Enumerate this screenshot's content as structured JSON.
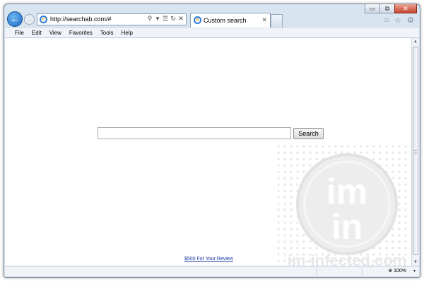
{
  "window": {
    "caption": {
      "minimize": "▭",
      "restore": "⧉",
      "close": "✕"
    }
  },
  "toolbar": {
    "back_icon": "back-arrow-icon",
    "forward_icon": "forward-arrow-icon",
    "back_glyph": "←",
    "forward_glyph": "→"
  },
  "address": {
    "url": "http://searchab.com/#",
    "icons": [
      "search-icon",
      "dropdown-icon",
      "compat-view-icon",
      "refresh-icon",
      "stop-icon"
    ],
    "icon_glyphs": [
      "⚲",
      "▾",
      "☰",
      "↻",
      "✕"
    ]
  },
  "tabs": [
    {
      "label": "Custom search",
      "close": "✕"
    }
  ],
  "right_toolbar": {
    "icons": [
      "home-icon",
      "favorites-icon",
      "tools-gear-icon"
    ],
    "glyphs": [
      "⌂",
      "☆",
      "⚙"
    ]
  },
  "menu": {
    "items": [
      "File",
      "Edit",
      "View",
      "Favorites",
      "Tools",
      "Help"
    ]
  },
  "page": {
    "search_input_value": "",
    "search_button": "Search",
    "review_link": "$500 For Your Review"
  },
  "watermark": {
    "logo_text_top": "im",
    "logo_text_bottom": "in",
    "site_text": "im-infected.com"
  },
  "status": {
    "zoom": "100%",
    "zoom_caret": "▾"
  },
  "colors": {
    "link": "#1a35a3",
    "chrome_blue": "#d9e4f1",
    "back_button": "#1c68c4"
  }
}
